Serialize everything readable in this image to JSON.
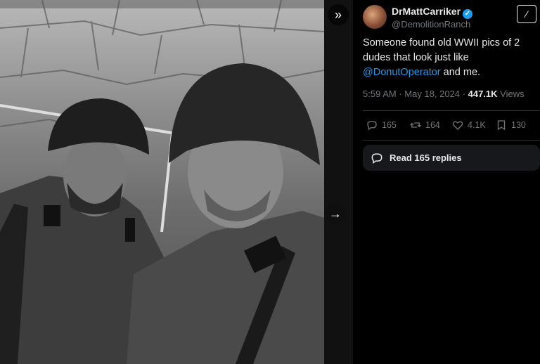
{
  "author": {
    "display_name": "DrMattCarriker",
    "handle": "@DemolitionRanch",
    "verified": true
  },
  "tweet": {
    "text_before": "Someone found old WWII pics of 2 dudes that look just like",
    "mention": "@DonutOperator",
    "text_after": " and me.",
    "time": "5:59 AM",
    "date": "May 18, 2024",
    "views_count": "447.1K",
    "views_label": "Views"
  },
  "actions": {
    "replies": "165",
    "reposts": "164",
    "likes": "4.1K",
    "bookmarks": "130"
  },
  "read_replies_label": "Read 165 replies",
  "icons": {
    "collapse": "double-chevron-right-icon",
    "next": "arrow-right-icon",
    "grok": "grok-icon"
  },
  "colors": {
    "accent": "#1d9bf0",
    "secondary_text": "#71767b",
    "primary_text": "#e7e9ea"
  }
}
